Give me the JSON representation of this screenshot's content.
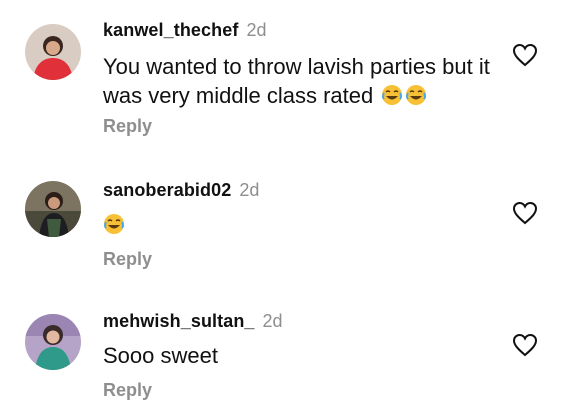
{
  "comments": [
    {
      "username": "kanwel_thechef",
      "time": "2d",
      "text": "You wanted to throw lavish parties but it was very middle class rated",
      "emojis": [
        "joy-emoji",
        "joy-emoji"
      ],
      "reply_label": "Reply",
      "like_icon": "heart-outline-icon"
    },
    {
      "username": "sanoberabid02",
      "time": "2d",
      "text": "",
      "emojis": [
        "joy-emoji"
      ],
      "reply_label": "Reply",
      "like_icon": "heart-outline-icon"
    },
    {
      "username": "mehwish_sultan_",
      "time": "2d",
      "text": "Sooo sweet",
      "emojis": [],
      "reply_label": "Reply",
      "like_icon": "heart-outline-icon"
    }
  ],
  "colors": {
    "text": "#111111",
    "secondary": "#8e8e8e",
    "emoji_face": "#f7c035"
  }
}
